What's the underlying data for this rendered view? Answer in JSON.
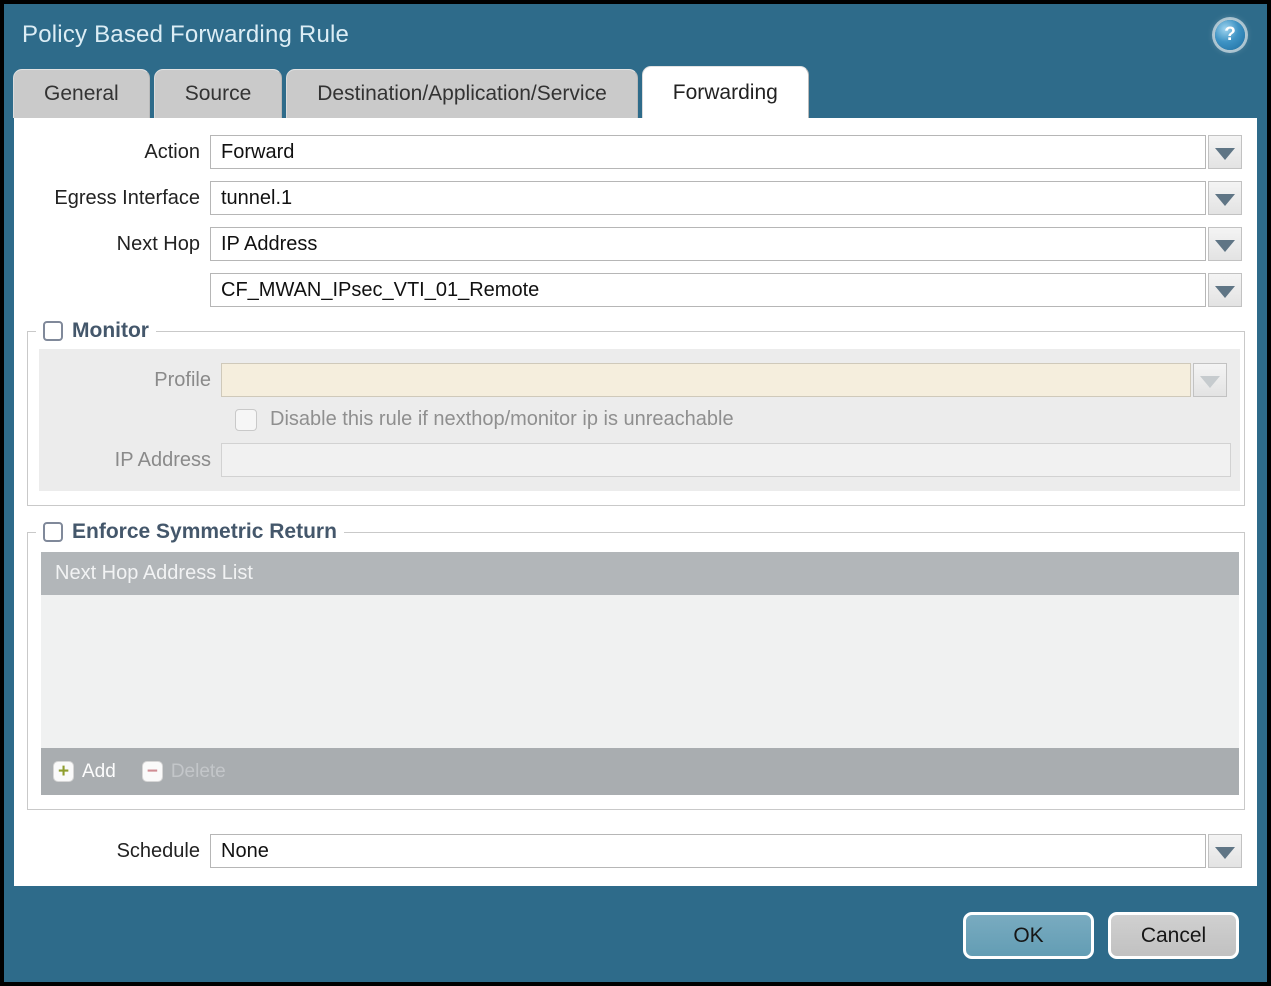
{
  "dialog": {
    "title": "Policy Based Forwarding Rule",
    "help_glyph": "?"
  },
  "tabs": [
    {
      "label": "General",
      "active": false
    },
    {
      "label": "Source",
      "active": false
    },
    {
      "label": "Destination/Application/Service",
      "active": false
    },
    {
      "label": "Forwarding",
      "active": true
    }
  ],
  "form": {
    "action": {
      "label": "Action",
      "value": "Forward"
    },
    "egress_interface": {
      "label": "Egress Interface",
      "value": "tunnel.1"
    },
    "next_hop": {
      "label": "Next Hop",
      "value": "IP Address"
    },
    "next_hop_address": {
      "value": "CF_MWAN_IPsec_VTI_01_Remote"
    },
    "schedule": {
      "label": "Schedule",
      "value": "None"
    }
  },
  "monitor": {
    "legend": "Monitor",
    "checked": false,
    "profile": {
      "label": "Profile",
      "value": ""
    },
    "disable_rule_label": "Disable this rule if nexthop/monitor ip is unreachable",
    "disable_rule_checked": false,
    "ip_address": {
      "label": "IP Address",
      "value": ""
    }
  },
  "symmetric_return": {
    "legend": "Enforce Symmetric Return",
    "checked": false,
    "table_header": "Next Hop Address List",
    "rows": [],
    "add_label": "Add",
    "delete_label": "Delete",
    "delete_enabled": false
  },
  "footer": {
    "ok_label": "OK",
    "cancel_label": "Cancel"
  },
  "colors": {
    "header_teal": "#2e6b8a",
    "tab_gray": "#cacaca",
    "disabled_panel": "#ececec",
    "profile_beige": "#f5eedd",
    "table_header_gray": "#b2b6b9",
    "table_footer_gray": "#a9adb0",
    "ok_button": "#6da4ba",
    "legend_slate": "#44576b"
  }
}
